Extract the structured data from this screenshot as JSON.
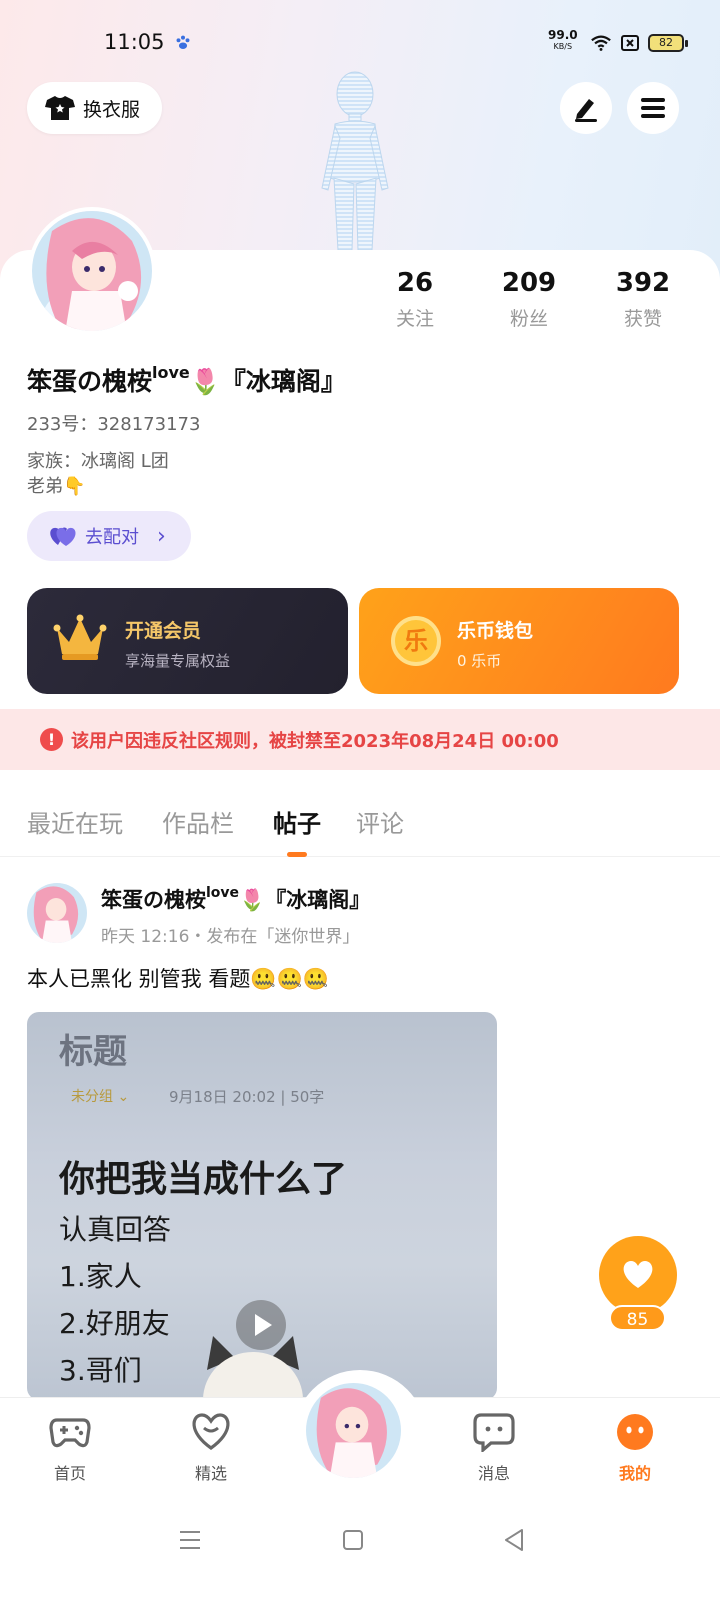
{
  "status_bar": {
    "time": "11:05",
    "net_speed": "99.0",
    "net_unit": "KB/S",
    "battery": "82"
  },
  "header": {
    "wardrobe_label": "换衣服",
    "edit_icon": "pen-icon",
    "menu_icon": "hamburger-menu-icon"
  },
  "profile": {
    "stats": [
      {
        "num": "26",
        "label": "关注"
      },
      {
        "num": "209",
        "label": "粉丝"
      },
      {
        "num": "392",
        "label": "获赞"
      }
    ],
    "name_main": "笨蛋の槐桉",
    "name_sup": "love",
    "name_suffix": "🌷『冰璃阁』",
    "uid": "233号：328173173",
    "family": "家族：冰璃阁 L团",
    "bio": "老弟👇",
    "match_label": "去配对",
    "match_arrow": "›"
  },
  "cards": {
    "vip_title": "开通会员",
    "vip_sub": "享海量专属权益",
    "wallet_title": "乐币钱包",
    "wallet_sub": "0 乐币",
    "wallet_icon_char": "乐"
  },
  "ban_notice": {
    "icon": "!",
    "text": "该用户因违反社区规则，被封禁至2023年08月24日 00:00"
  },
  "tabs": [
    {
      "label": "最近在玩"
    },
    {
      "label": "作品栏"
    },
    {
      "label": "帖子"
    },
    {
      "label": "评论"
    }
  ],
  "post": {
    "user_main": "笨蛋の槐桉",
    "user_sup": "love",
    "user_suffix": "🌷『冰璃阁』",
    "meta": "昨天 12:16・发布在「迷你世界」",
    "text": "本人已黑化 别管我 看题🤐🤐🤐",
    "image": {
      "title": "标题",
      "group": "未分组 ⌄",
      "date": "9月18日 20:02  |  50字",
      "question": "你把我当成什么了",
      "lines": [
        "认真回答",
        "1.家人",
        "2.好朋友",
        "3.哥们"
      ]
    }
  },
  "like": {
    "count": "85"
  },
  "bottom_nav": [
    {
      "label": "首页",
      "icon": "gamepad-icon"
    },
    {
      "label": "精选",
      "icon": "heart-icon"
    },
    {
      "label": "",
      "icon": "avatar"
    },
    {
      "label": "消息",
      "icon": "chat-icon"
    },
    {
      "label": "我的",
      "icon": "smile-face-icon"
    }
  ],
  "colors": {
    "accent": "#ff7a1f",
    "ban_text": "#e64545",
    "vip_gold": "#f5c769",
    "match_purple": "#5b4ed0"
  }
}
